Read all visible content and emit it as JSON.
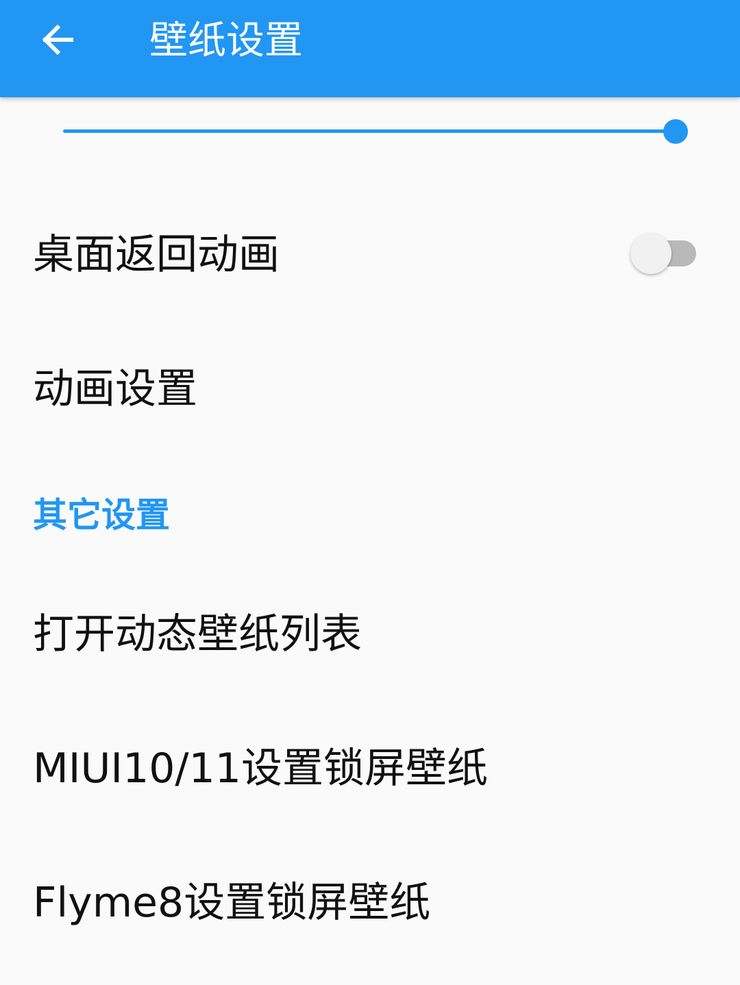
{
  "appbar": {
    "title": "壁纸设置",
    "back_icon": "arrow-left-icon",
    "background_color": "#2196f3"
  },
  "slider": {
    "value_fraction": 1.0,
    "accent_color": "#2196f3"
  },
  "settings": {
    "desktop_return_animation": {
      "label": "桌面返回动画",
      "enabled": false
    },
    "animation_settings": {
      "label": "动画设置"
    }
  },
  "other_section": {
    "header": "其它设置",
    "items": [
      {
        "label": "打开动态壁纸列表"
      },
      {
        "label": "MIUI10/11设置锁屏壁纸"
      },
      {
        "label": "Flyme8设置锁屏壁纸"
      }
    ]
  }
}
